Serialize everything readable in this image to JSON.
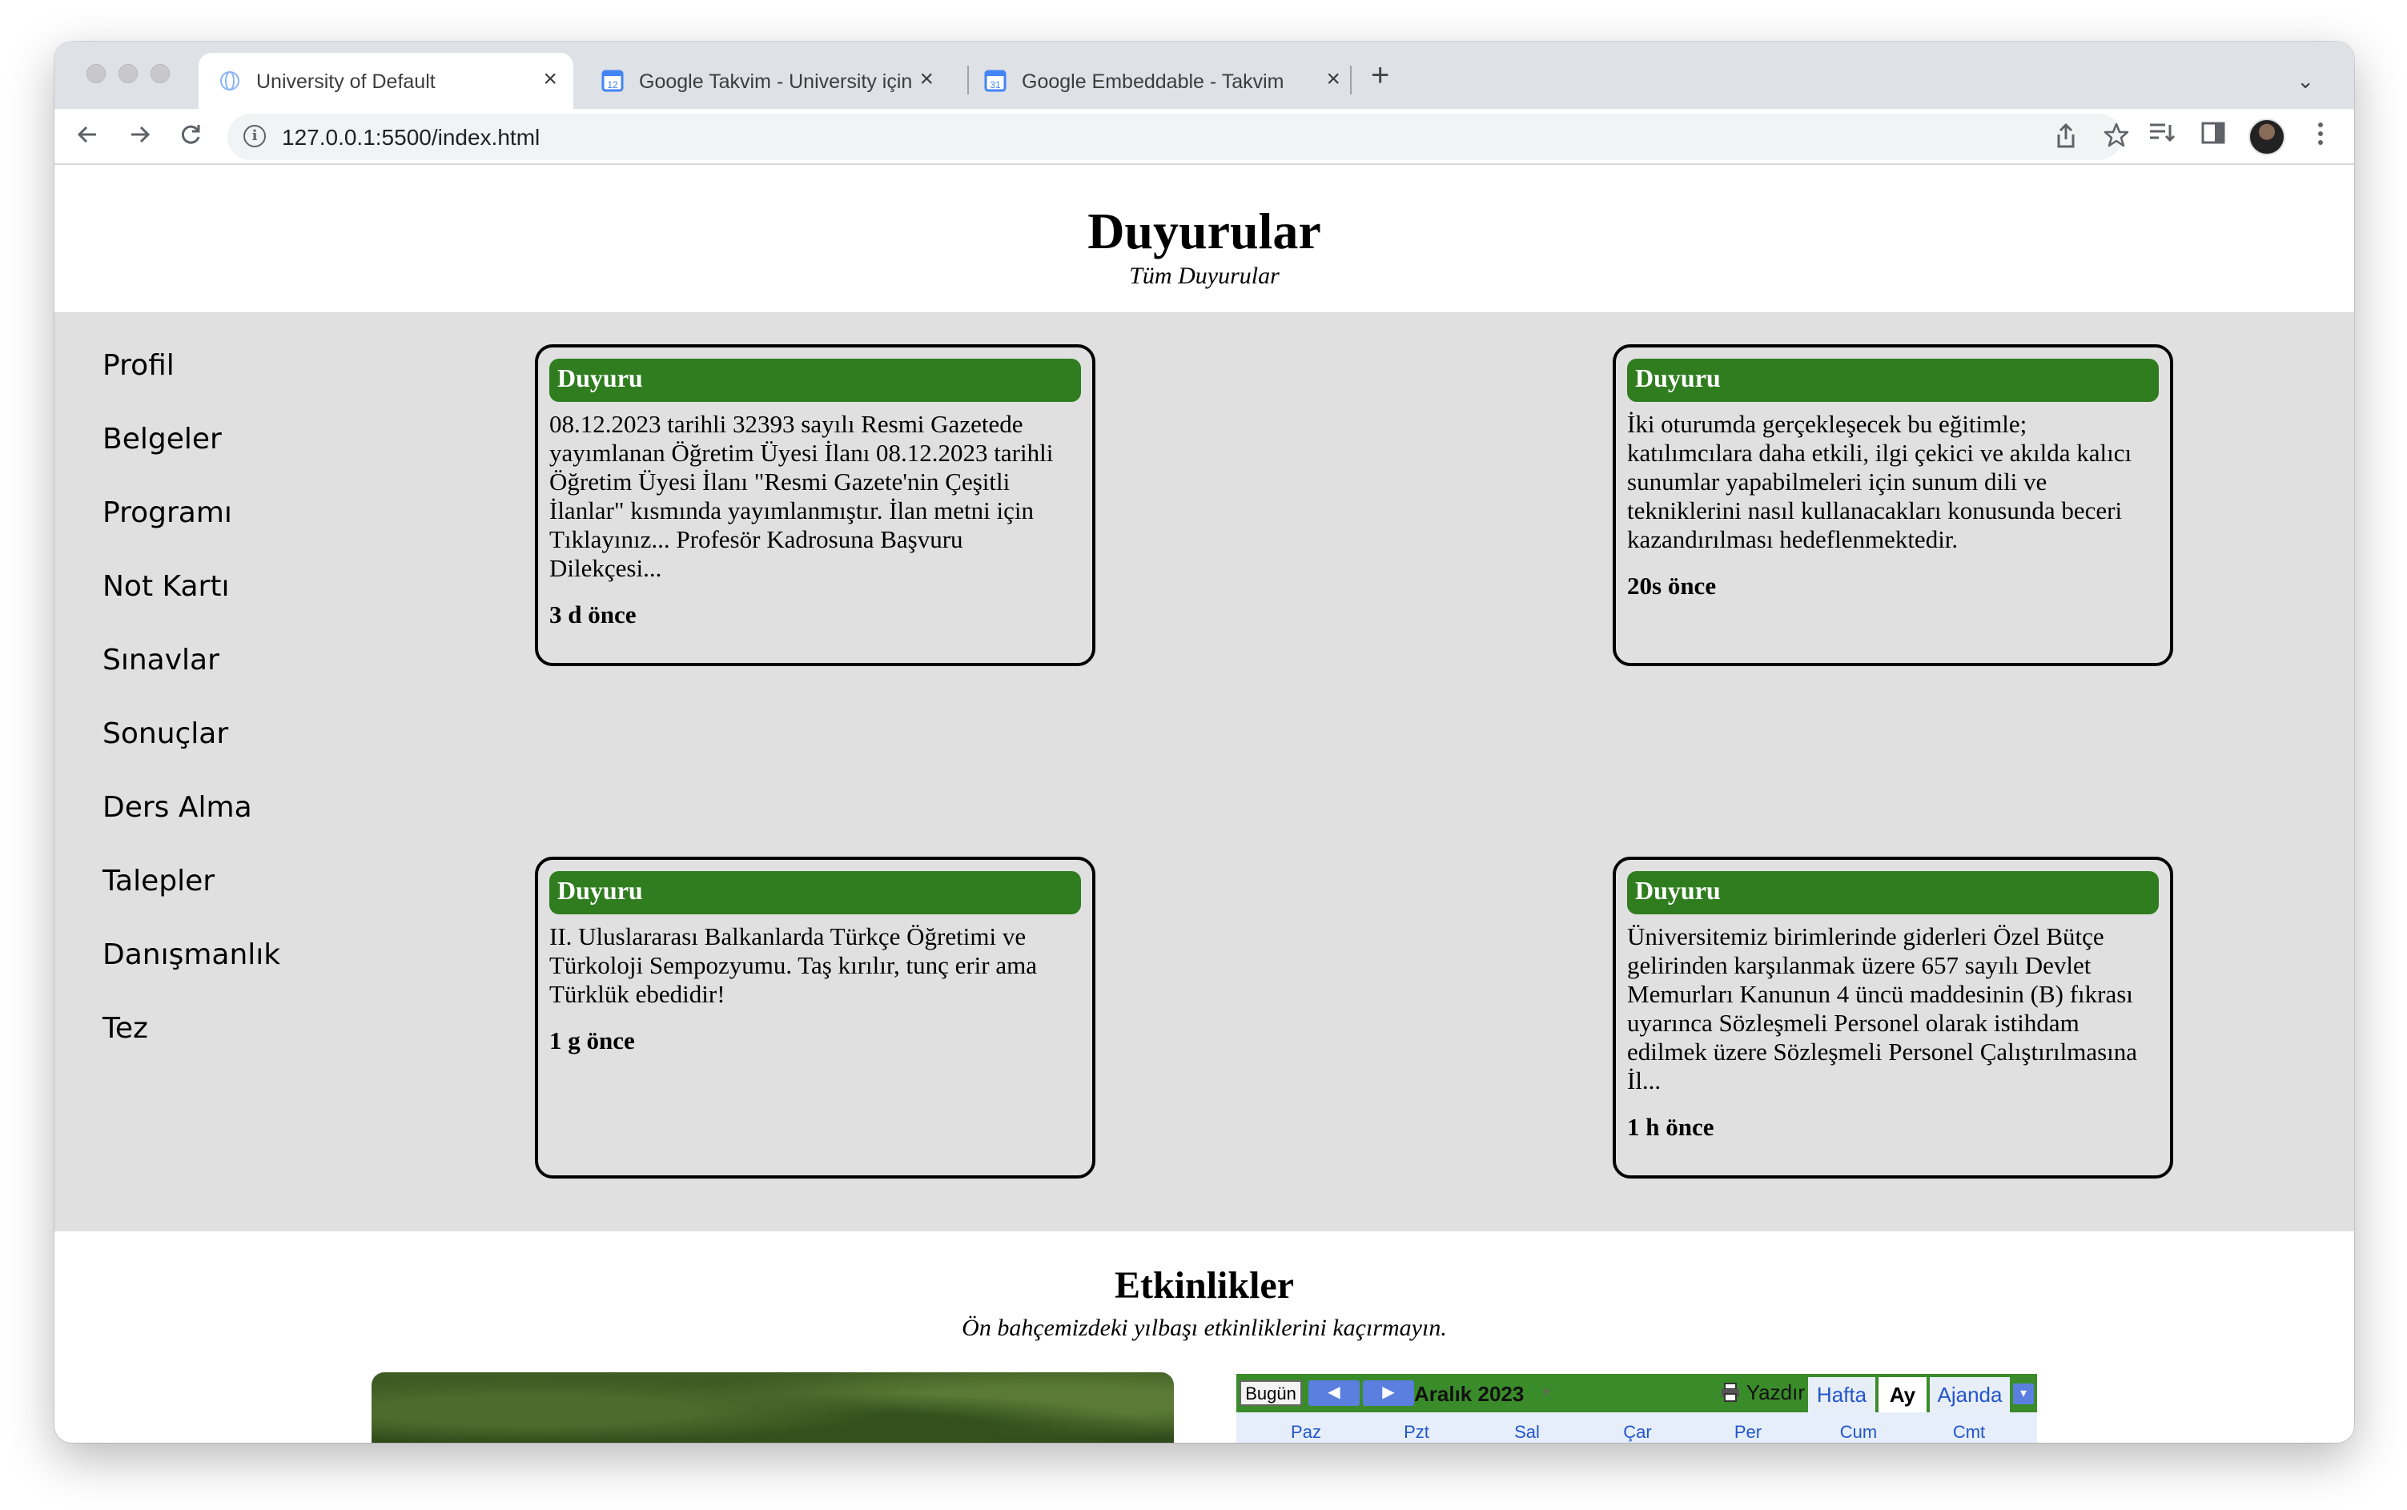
{
  "browser": {
    "tabs": [
      {
        "title": "University of Default",
        "close": "×"
      },
      {
        "title": "Google Takvim - University için",
        "close": "×"
      },
      {
        "title": "Google Embeddable - Takvim",
        "close": "×"
      }
    ],
    "new_tab": "+",
    "tab_list": "⌄",
    "url": "127.0.0.1:5500/index.html",
    "info_glyph": "i",
    "icons": [
      "back-icon",
      "forward-icon",
      "reload-icon",
      "share-icon",
      "star-icon",
      "reading-list-icon",
      "side-panel-icon",
      "menu-icon"
    ]
  },
  "header": {
    "title": "Duyurular",
    "subtitle": "Tüm Duyurular"
  },
  "sidebar": {
    "items": [
      {
        "label": "Profil"
      },
      {
        "label": "Belgeler"
      },
      {
        "label": "Programı"
      },
      {
        "label": "Not Kartı"
      },
      {
        "label": "Sınavlar"
      },
      {
        "label": "Sonuçlar"
      },
      {
        "label": "Ders Alma"
      },
      {
        "label": "Talepler"
      },
      {
        "label": "Danışmanlık"
      },
      {
        "label": "Tez"
      }
    ]
  },
  "announcements": [
    {
      "header": "Duyuru",
      "body": "08.12.2023 tarihli 32393 sayılı Resmi Gazetede yayımlanan Öğretim Üyesi İlanı 08.12.2023 tarihli Öğretim Üyesi İlanı \"Resmi Gazete'nin Çeşitli İlanlar\" kısmında yayımlanmıştır. İlan metni için Tıklayınız... Profesör Kadrosuna Başvuru Dilekçesi...",
      "time": "3 d önce"
    },
    {
      "header": "Duyuru",
      "body": "İki oturumda gerçekleşecek bu eğitimle; katılımcılara daha etkili, ilgi çekici ve akılda kalıcı sunumlar yapabilmeleri için sunum dili ve tekniklerini nasıl kullanacakları konusunda beceri kazandırılması hedeflenmektedir.",
      "time": "20s önce"
    },
    {
      "header": "Duyuru",
      "body": "II. Uluslararası Balkanlarda Türkçe Öğretimi ve Türkoloji Sempozyumu. Taş kırılır, tunç erir ama Türklük ebedidir!",
      "time": "1 g önce"
    },
    {
      "header": "Duyuru",
      "body": "Üniversitemiz birimlerinde giderleri Özel Bütçe gelirinden karşılanmak üzere 657 sayılı Devlet Memurları Kanunun 4 üncü maddesinin (B) fıkrası uyarınca Sözleşmeli Personel olarak istihdam edilmek üzere Sözleşmeli Personel Çalıştırılmasına İl...",
      "time": "1 h önce"
    }
  ],
  "events": {
    "title": "Etkinlikler",
    "subtitle": "Ön bahçemizdeki yılbaşı etkinliklerini kaçırmayın."
  },
  "calendar": {
    "today": "Bugün",
    "prev": "◀",
    "next": "▶",
    "month": "Aralık 2023",
    "caret": "▾",
    "print": "Yazdır",
    "views": [
      "Hafta",
      "Ay",
      "Ajanda"
    ],
    "active_view": "Ay",
    "dropdown": "▾",
    "days": [
      "Paz",
      "Pzt",
      "Sal",
      "Çar",
      "Per",
      "Cum",
      "Cmt"
    ]
  },
  "colors": {
    "card_header": "#2f7d1f",
    "content_bg": "#e0e0e0",
    "calendar_bar": "#3a8c2a"
  }
}
